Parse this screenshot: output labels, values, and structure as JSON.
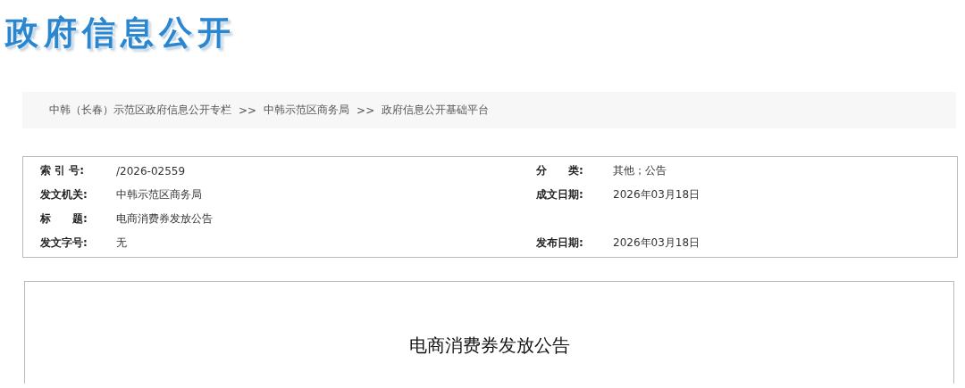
{
  "logo": {
    "text": "政府信息公开"
  },
  "breadcrumb": {
    "links": [
      "中韩（长春）示范区政府信息公开专栏",
      "中韩示范区商务局",
      "政府信息公开基础平台"
    ],
    "separators": [
      ">>",
      ">>"
    ]
  },
  "meta": [
    {
      "left": {
        "label": "索 引 号:",
        "value": "/2026-02559"
      },
      "right": {
        "label": "分　　类:",
        "value": "其他；公告"
      }
    },
    {
      "left": {
        "label": "发文机关:",
        "value": "中韩示范区商务局"
      },
      "right": {
        "label": "成文日期:",
        "value": "2026年03月18日"
      }
    },
    {
      "left": {
        "label": "标　　题:",
        "value": "电商消费券发放公告"
      }
    },
    {
      "left": {
        "label": "发文字号:",
        "value": "无"
      },
      "right": {
        "label": "发布日期:",
        "value": "2026年03月18日"
      }
    }
  ],
  "article": {
    "title": "电商消费券发放公告"
  }
}
